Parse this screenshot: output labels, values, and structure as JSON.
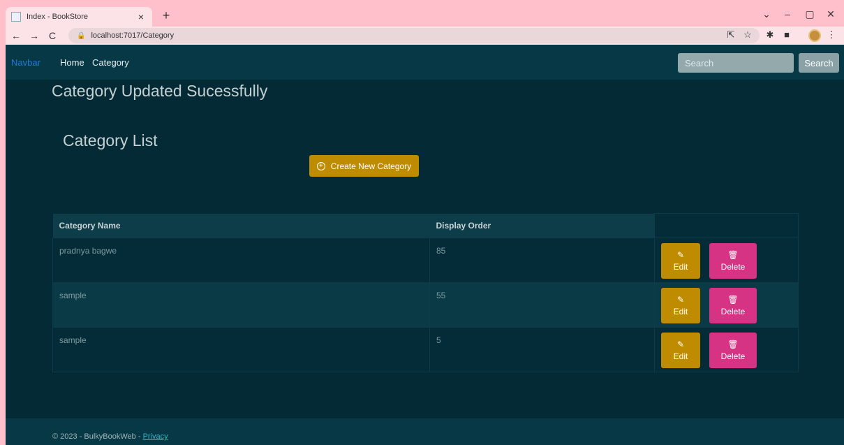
{
  "browser": {
    "tab_title": "Index - BookStore",
    "tab_close": "×",
    "new_tab": "+",
    "url": "localhost:7017/Category",
    "win_controls": [
      "⌄",
      "–",
      "▢",
      "✕"
    ]
  },
  "navbar": {
    "brand": "Navbar",
    "links": [
      "Home",
      "Category"
    ],
    "search_placeholder": "Search",
    "search_button": "Search"
  },
  "alert": {
    "message": "Category Updated Sucessfully"
  },
  "main": {
    "title": "Category List",
    "create_button": "Create New Category",
    "table": {
      "headers": [
        "Category Name",
        "Display Order"
      ],
      "rows": [
        {
          "name": "pradnya bagwe",
          "order": "85",
          "edit": "Edit",
          "delete": "Delete"
        },
        {
          "name": "sample",
          "order": "55",
          "edit": "Edit",
          "delete": "Delete"
        },
        {
          "name": "sample",
          "order": "5",
          "edit": "Edit",
          "delete": "Delete"
        }
      ]
    }
  },
  "footer": {
    "copyright": "© 2023 - BulkyBookWeb - ",
    "privacy_link": "Privacy"
  },
  "colors": {
    "page_bg": "#032a35",
    "navbar_bg": "#073846",
    "edit_button": "#bf8c00",
    "delete_button": "#d63384",
    "browser_chrome": "#ffc0cb"
  }
}
